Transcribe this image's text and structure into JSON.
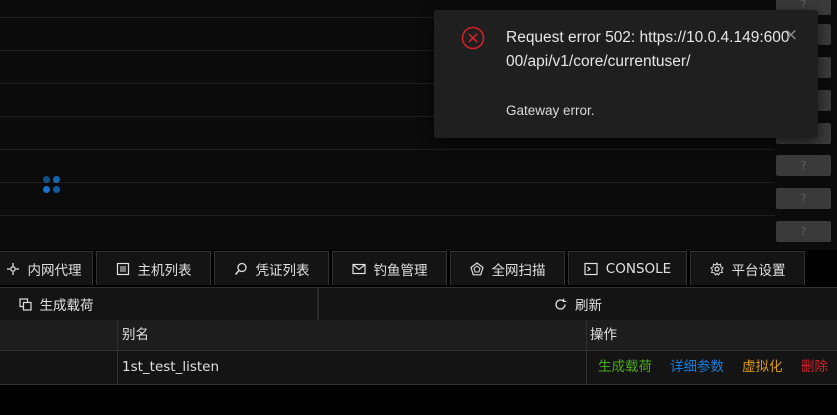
{
  "background_rows": {
    "help_button_label": "?"
  },
  "notification": {
    "message": "Request error 502: https://10.0.4.149:60000/api/v1/core/currentuser/",
    "description": "Gateway error.",
    "close_glyph": "×",
    "icon": "close-circle-icon",
    "icon_color": "#d32029"
  },
  "tabs": [
    {
      "label": "内网代理",
      "icon": "proxy-icon"
    },
    {
      "label": "主机列表",
      "icon": "host-list-icon"
    },
    {
      "label": "凭证列表",
      "icon": "search-icon"
    },
    {
      "label": "钓鱼管理",
      "icon": "mail-icon"
    },
    {
      "label": "全网扫描",
      "icon": "pentagon-icon"
    },
    {
      "label": "CONSOLE",
      "icon": "terminal-icon"
    },
    {
      "label": "平台设置",
      "icon": "gear-icon"
    }
  ],
  "actions": {
    "generate_label": "生成载荷",
    "refresh_label": "刷新"
  },
  "table": {
    "columns": [
      "别名",
      "操作"
    ],
    "rows": [
      {
        "alias": "1st_test_listen",
        "operations": [
          {
            "label": "生成载荷",
            "color": "#49aa19"
          },
          {
            "label": "详细参数",
            "color": "#177ddc"
          },
          {
            "label": "虚拟化",
            "color": "#d89614"
          },
          {
            "label": "删除",
            "color": "#d32029"
          }
        ]
      }
    ]
  },
  "colors": {
    "primary": "#177ddc",
    "success": "#49aa19",
    "warning": "#d89614",
    "danger": "#d32029"
  }
}
